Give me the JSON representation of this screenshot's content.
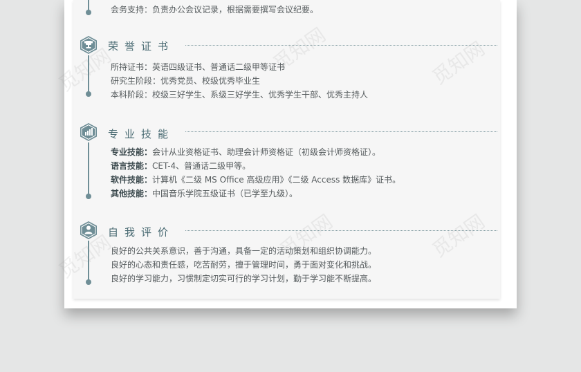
{
  "top_partial": {
    "text": "会务支持：负责办公会议记录，根据需要撰写会议纪要。"
  },
  "sections": [
    {
      "title": "荣誉证书",
      "icon": "trophy-icon",
      "lines": [
        {
          "text": "所持证书：英语四级证书、普通话二级甲等证书"
        },
        {
          "text": "研究生阶段：优秀党员、校级优秀毕业生"
        },
        {
          "text": "本科阶段：校级三好学生、系级三好学生、优秀学生干部、优秀主持人"
        }
      ]
    },
    {
      "title": "专业技能",
      "icon": "bar-chart-icon",
      "lines": [
        {
          "label": "专业技能：",
          "text": "会计从业资格证书、助理会计师资格证（初级会计师资格证）。"
        },
        {
          "label": "语言技能：",
          "text": "CET-4、普通话二级甲等。"
        },
        {
          "label": "软件技能：",
          "text": "计算机《二级 MS Office 高级应用》《二级 Access 数据库》证书。"
        },
        {
          "label": "其他技能：",
          "text": "中国音乐学院五级证书（已学至九级）。"
        }
      ]
    },
    {
      "title": "自我评价",
      "icon": "user-icon",
      "lines": [
        {
          "text": "良好的公共关系意识，善于沟通，具备一定的活动策划和组织协调能力。"
        },
        {
          "text": "良好的心态和责任感，吃苦耐劳，擅于管理时间，勇于面对变化和挑战。"
        },
        {
          "text": "良好的学习能力，习惯制定切实可行的学习计划，勤于学习能不断提高。"
        }
      ]
    }
  ],
  "watermark": "觅知网",
  "colors": {
    "accent": "#6f8e96",
    "title": "#4a6b73",
    "body_text": "#555b5d"
  }
}
